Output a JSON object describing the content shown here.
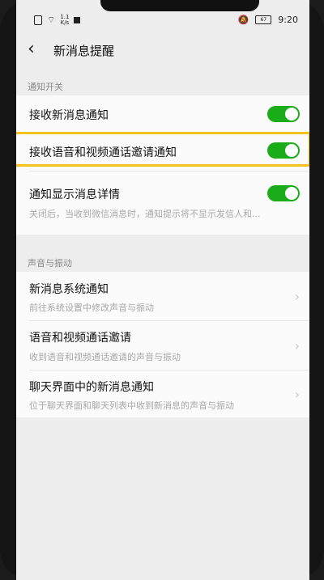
{
  "status_bar": {
    "speed": "1.1\nK/s",
    "battery": "67",
    "time": "9:20"
  },
  "header": {
    "back_icon": "chevron-left",
    "title": "新消息提醒"
  },
  "sections": {
    "notify": {
      "label": "通知开关",
      "items": [
        {
          "title": "接收新消息通知",
          "toggle": true
        },
        {
          "title": "接收语音和视频通话邀请通知",
          "toggle": true
        },
        {
          "title": "通知显示消息详情",
          "subtitle": "关闭后，当收到微信消息时，通知提示将不显示发信人和...",
          "toggle": true
        }
      ]
    },
    "sound": {
      "label": "声音与振动",
      "items": [
        {
          "title": "新消息系统通知",
          "subtitle": "前往系统设置中修改声音与振动"
        },
        {
          "title": "语音和视频通话邀请",
          "subtitle": "收到语音和视频通话邀请的声音与振动"
        },
        {
          "title": "聊天界面中的新消息通知",
          "subtitle": "位于聊天界面和聊天列表中收到新消息的声音与振动"
        }
      ]
    }
  },
  "colors": {
    "toggle_on": "#1aad19",
    "highlight": "#f4c21d",
    "background": "#ededed"
  }
}
